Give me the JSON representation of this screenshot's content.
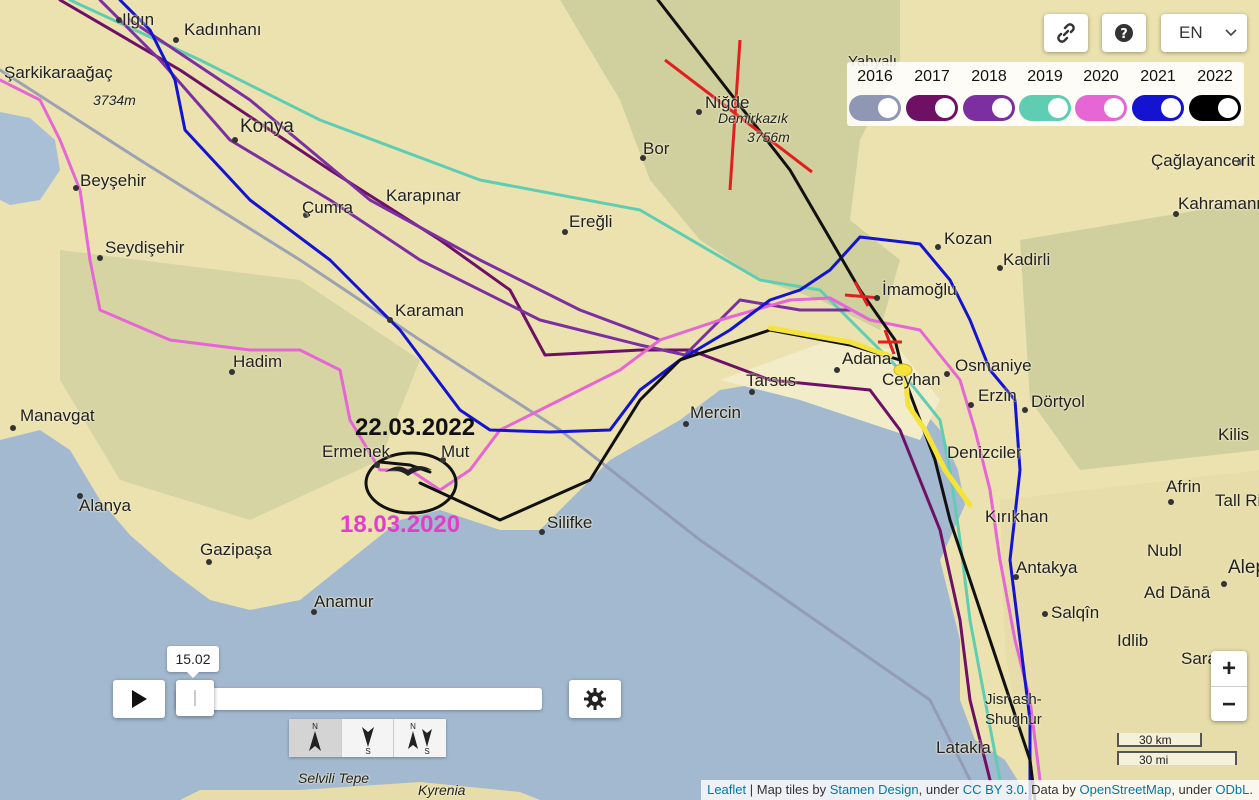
{
  "map": {
    "cities": [
      {
        "name": "Ilgın"
      },
      {
        "name": "Kadınhanı"
      },
      {
        "name": "Şarkikaraağaç"
      },
      {
        "name": "Konya"
      },
      {
        "name": "Beyşehir"
      },
      {
        "name": "Çumra"
      },
      {
        "name": "Karapınar"
      },
      {
        "name": "Ereğli"
      },
      {
        "name": "Seydişehir"
      },
      {
        "name": "Karaman"
      },
      {
        "name": "Hadim"
      },
      {
        "name": "Manavgat"
      },
      {
        "name": "Ermenek"
      },
      {
        "name": "Mut"
      },
      {
        "name": "Alanya"
      },
      {
        "name": "Gazipaşa"
      },
      {
        "name": "Anamur"
      },
      {
        "name": "Silifke"
      },
      {
        "name": "Mercin"
      },
      {
        "name": "Tarsus"
      },
      {
        "name": "Adana"
      },
      {
        "name": "Ceyhan"
      },
      {
        "name": "Niğde"
      },
      {
        "name": "Bor"
      },
      {
        "name": "Yahyalı"
      },
      {
        "name": "Kozan"
      },
      {
        "name": "Kadirli"
      },
      {
        "name": "İmamoğlu"
      },
      {
        "name": "Osmaniye"
      },
      {
        "name": "Erzin"
      },
      {
        "name": "Dörtyol"
      },
      {
        "name": "Denizciler"
      },
      {
        "name": "Kırıkhan"
      },
      {
        "name": "Antakya"
      },
      {
        "name": "Salqîn"
      },
      {
        "name": "Idlib"
      },
      {
        "name": "Saraqib"
      },
      {
        "name": "Nubl"
      },
      {
        "name": "Ad Dānā"
      },
      {
        "name": "Afrin"
      },
      {
        "name": "Kilis"
      },
      {
        "name": "Tall Ri"
      },
      {
        "name": "Alep"
      },
      {
        "name": "Kahramanm"
      },
      {
        "name": "Çağlayancerit"
      },
      {
        "name": "Latakia"
      },
      {
        "name": "Jisr ash-Shughur"
      },
      {
        "name": "Selvili Tepe"
      },
      {
        "name": "Kyrenia"
      }
    ],
    "peaks": [
      {
        "name": "3734m"
      },
      {
        "name": "Demirkazık"
      },
      {
        "name": "3756m"
      }
    ],
    "annotations": {
      "date_black": "22.03.2022",
      "date_pink": "18.03.2020"
    },
    "colors": {
      "sea": "#9fb6cc",
      "land": "#ebe2b0"
    }
  },
  "controls": {
    "link_icon": "link-icon",
    "help_icon": "question-icon",
    "language": "EN",
    "years": [
      {
        "label": "2016",
        "color": "#8f97b4"
      },
      {
        "label": "2017",
        "color": "#6e1164"
      },
      {
        "label": "2018",
        "color": "#7b2fa0"
      },
      {
        "label": "2019",
        "color": "#5fcdb1"
      },
      {
        "label": "2020",
        "color": "#e566d4"
      },
      {
        "label": "2021",
        "color": "#1313d0"
      },
      {
        "label": "2022",
        "color": "#000000"
      }
    ],
    "zoom_in": "+",
    "zoom_out": "−",
    "playback": {
      "time": "15.02",
      "progress": 0.0
    },
    "directions": [
      {
        "top": "N",
        "bottom": ""
      },
      {
        "top": "",
        "bottom": "S"
      },
      {
        "top": "N",
        "bottom": "S"
      }
    ],
    "scale": {
      "km": "30 km",
      "mi": "30 mi"
    }
  },
  "attribution": {
    "leaflet": "Leaflet",
    "t1": " | Map tiles by ",
    "stamen": "Stamen Design",
    "t2": ", under ",
    "cc": "CC BY 3.0",
    "t3": ". Data by ",
    "osm": "OpenStreetMap",
    "t4": ", under ",
    "odbl": "ODbL",
    "t5": "."
  }
}
